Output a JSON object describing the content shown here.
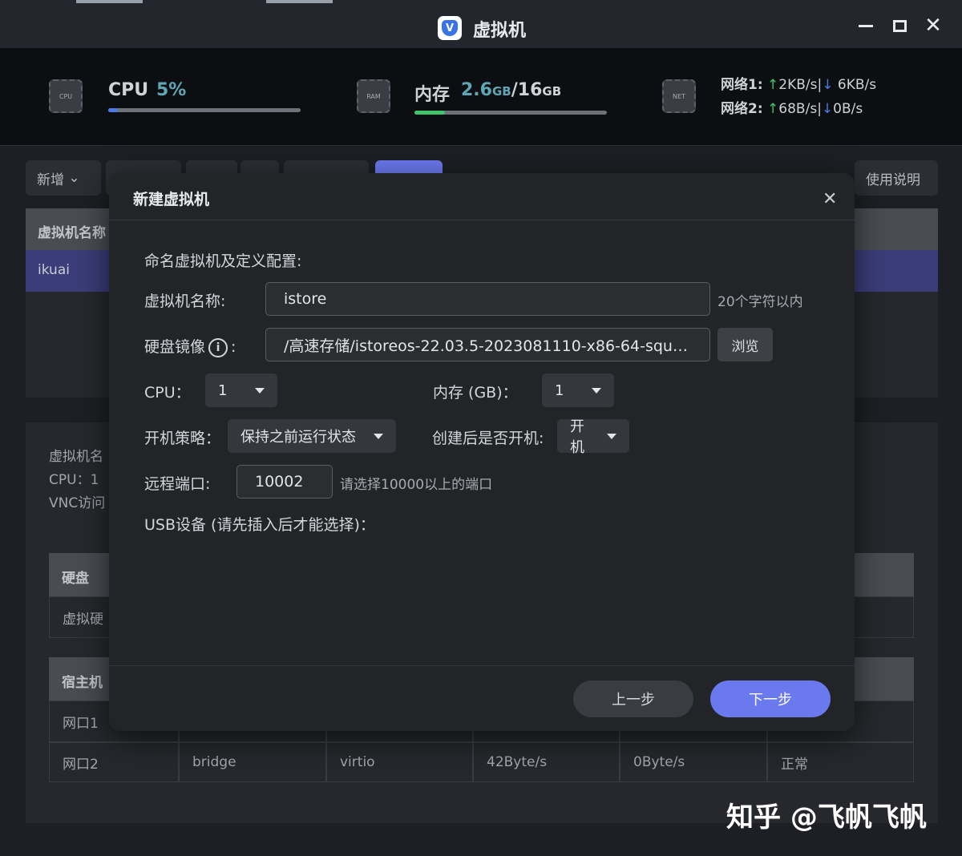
{
  "window": {
    "title": "虚拟机",
    "app_icon_letter": "V"
  },
  "stats": {
    "cpu": {
      "label": "CPU",
      "value": "5%",
      "percent": 5,
      "chip_text": "CPU"
    },
    "memory": {
      "label": "内存",
      "used": "2.6",
      "used_unit": "GB",
      "sep": "/",
      "total": "16",
      "total_unit": "GB",
      "percent": 16,
      "chip_text": "RAM"
    },
    "network": {
      "chip_text": "NET",
      "lines": [
        {
          "label": "网络1:",
          "up": "2KB/s",
          "sep": "|",
          "down": "6KB/s"
        },
        {
          "label": "网络2:",
          "up": "68B/s",
          "sep": "|",
          "down": "0B/s"
        }
      ]
    }
  },
  "toolbar": {
    "add_label": "新增",
    "help_label": "使用说明"
  },
  "background": {
    "table_header": "虚拟机名称",
    "row_name": "ikuai",
    "detail_name_label": "虚拟机名",
    "detail_cpu": "CPU：1",
    "detail_vnc": "VNC访问",
    "disk_header": "硬盘",
    "disk_row": "虚拟硬",
    "host_header": "宿主机",
    "net_rows": [
      {
        "name": "网口1"
      },
      {
        "name": "网口2",
        "mode": "bridge",
        "driver": "virtio",
        "rx": "42Byte/s",
        "tx": "0Byte/s",
        "status": "正常"
      }
    ]
  },
  "dialog": {
    "title": "新建虚拟机",
    "intro": "命名虚拟机及定义配置:",
    "name_label": "虚拟机名称:",
    "name_value": "istore",
    "name_hint": "20个字符以内",
    "image_label": "硬盘镜像",
    "image_info": "i",
    "image_colon": ":",
    "image_value": "/高速存储/istoreos-22.03.5-2023081110-x86-64-squa...",
    "browse_label": "浏览",
    "cpu_label": "CPU：",
    "cpu_value": "1",
    "mem_label": "内存 (GB)：",
    "mem_value": "1",
    "boot_label": "开机策略：",
    "boot_value": "保持之前运行状态",
    "start_label": "创建后是否开机:",
    "start_value": "开机",
    "port_label": "远程端口:",
    "port_value": "10002",
    "port_hint": "请选择10000以上的端口",
    "usb_label": "USB设备 (请先插入后才能选择)：",
    "prev_label": "上一步",
    "next_label": "下一步"
  },
  "watermark": "知乎 @飞帆飞帆",
  "colors": {
    "accent": "#6b79ee",
    "cpu_value": "#5fa6b5",
    "up_arrow": "#3ec46d",
    "down_arrow": "#4a7ce6"
  }
}
